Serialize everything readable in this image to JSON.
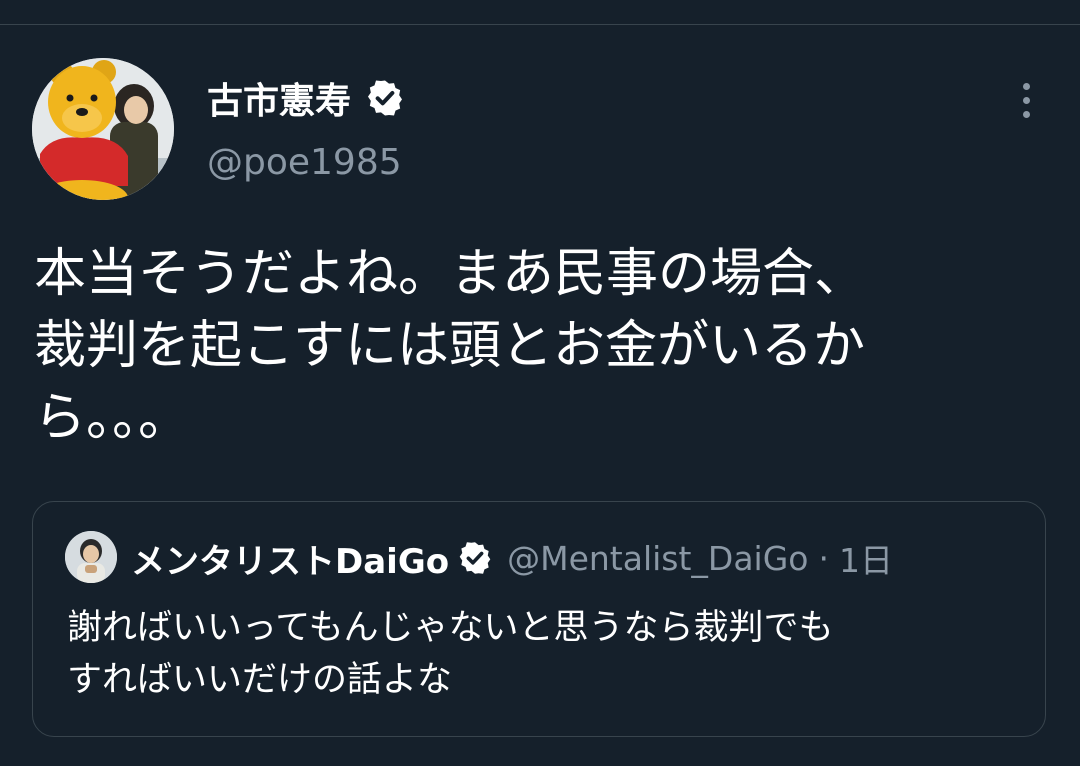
{
  "tweet": {
    "author": {
      "display_name": "古市憲寿",
      "handle": "@poe1985",
      "verified": true,
      "avatar_icon": "avatar-bear-mascot-photo"
    },
    "text": "本当そうだよね。まあ民事の場合、\n裁判を起こすには頭とお金がいるか\nら。。。",
    "more_icon": "more-vertical-icon"
  },
  "quote": {
    "author": {
      "display_name": "メンタリストDaiGo",
      "handle": "@Mentalist_DaiGo",
      "verified": true,
      "avatar_icon": "avatar-person-photo"
    },
    "separator": "·",
    "time": "1日",
    "text": "謝ればいいってもんじゃないと思うなら裁判でも\nすればいいだけの話よな"
  },
  "colors": {
    "background": "#15202b",
    "border": "#38444d",
    "secondary_text": "#8b98a5",
    "primary_text": "#ffffff"
  }
}
